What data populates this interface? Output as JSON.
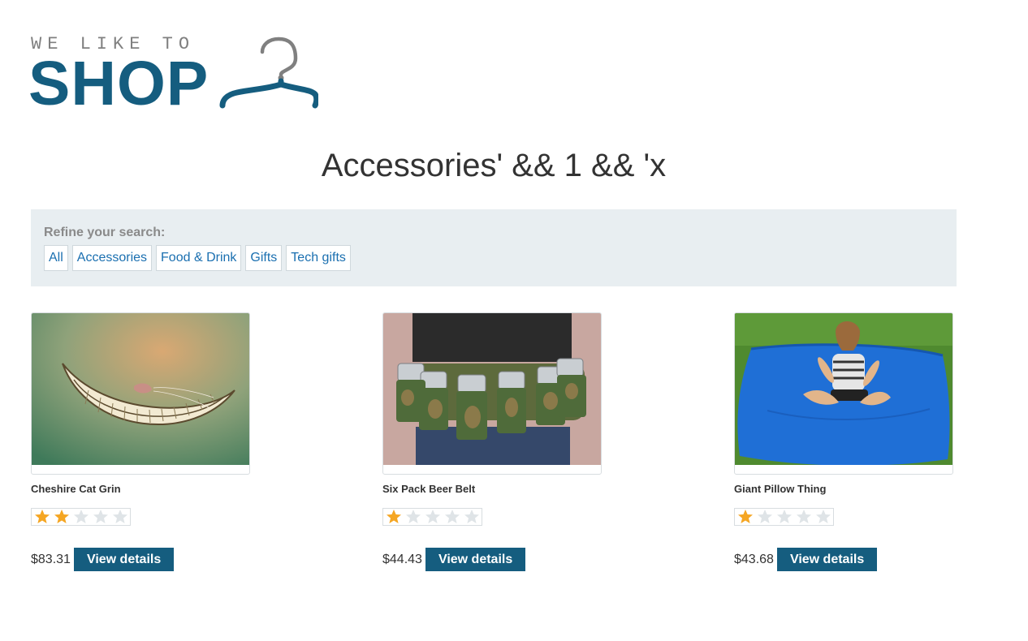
{
  "logo": {
    "tagline": "WE LIKE TO",
    "brand": "SHOP"
  },
  "heading": "Accessories' && 1 && 'x",
  "filters": {
    "label": "Refine your search:",
    "links": [
      "All",
      "Accessories",
      "Food & Drink",
      "Gifts",
      "Tech gifts"
    ]
  },
  "products": [
    {
      "name": "Cheshire Cat Grin",
      "rating": 2,
      "max_rating": 5,
      "price": "$83.31",
      "button": "View details"
    },
    {
      "name": "Six Pack Beer Belt",
      "rating": 1,
      "max_rating": 5,
      "price": "$44.43",
      "button": "View details"
    },
    {
      "name": "Giant Pillow Thing",
      "rating": 1,
      "max_rating": 5,
      "price": "$43.68",
      "button": "View details"
    }
  ],
  "colors": {
    "brand": "#155d7f",
    "link": "#1a6fb0",
    "filter_bg": "#e8eef1",
    "star_filled": "#f5a623",
    "star_empty": "#dfe4e7"
  }
}
